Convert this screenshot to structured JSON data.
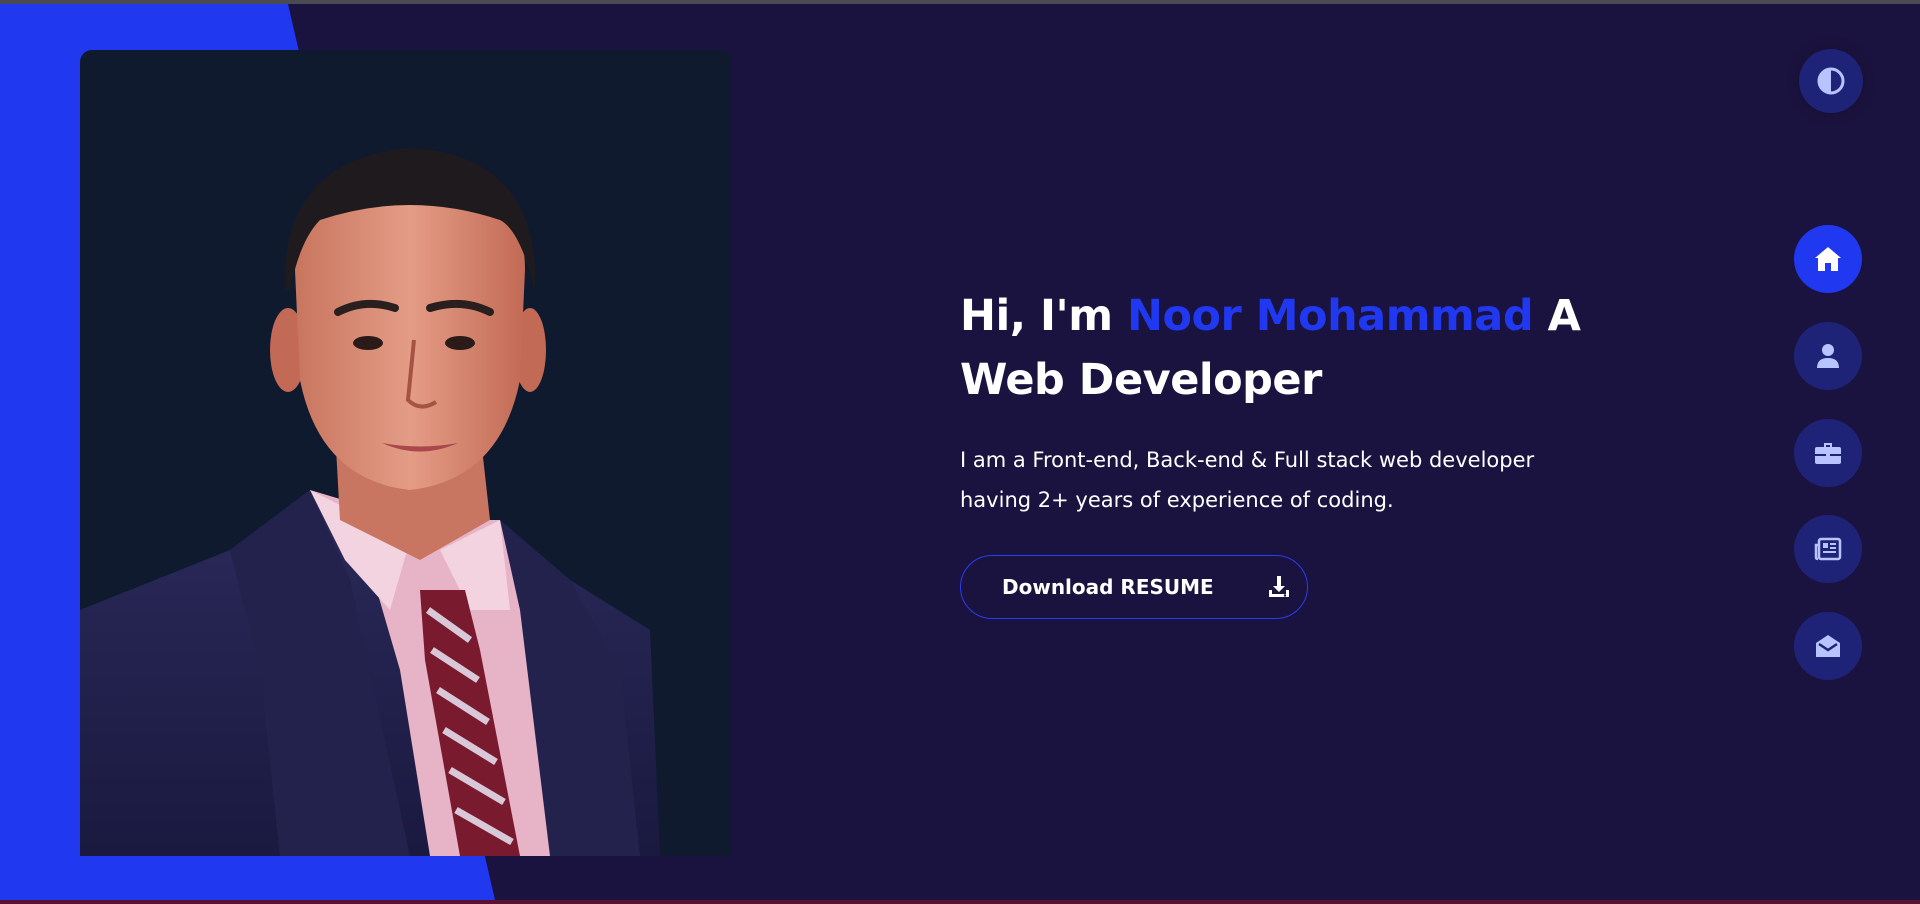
{
  "hero": {
    "greeting": "Hi, I'm ",
    "name": "Noor Mohammad",
    "role_prefix": " A",
    "role": "Web Developer",
    "description": "I am a Front-end, Back-end & Full stack web developer having 2+ years of experience of coding.",
    "download_label": "Download RESUME"
  },
  "icons": {
    "theme_toggle": "half-circle-contrast-icon",
    "download": "download-icon",
    "nav": [
      "home-icon",
      "user-icon",
      "briefcase-icon",
      "newspaper-icon",
      "envelope-open-icon"
    ]
  },
  "nav": {
    "active_index": 0
  },
  "colors": {
    "background": "#1b133f",
    "accent": "#1f38f0",
    "nav_button": "#1f2377",
    "photo_background": "#0f1a2e",
    "text": "#ffffff"
  }
}
